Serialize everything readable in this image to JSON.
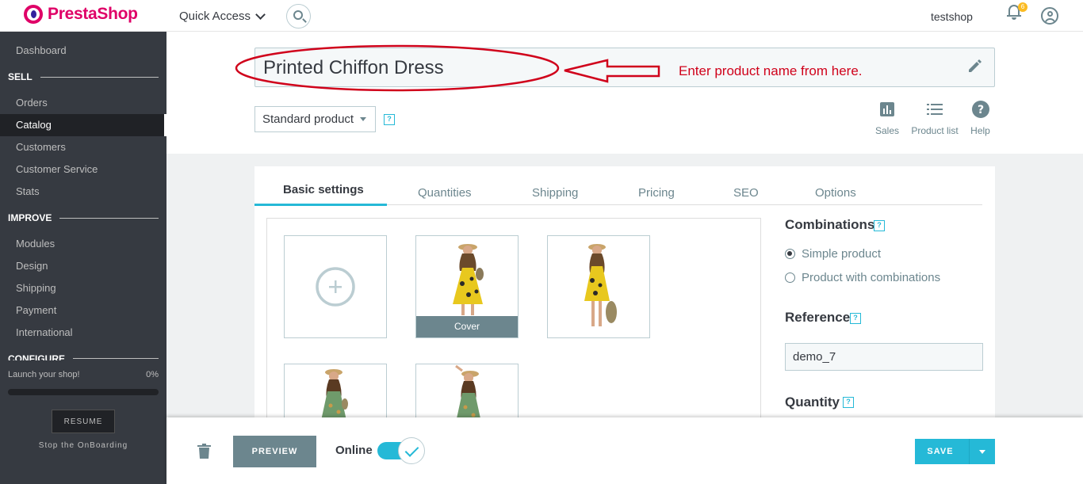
{
  "header": {
    "brand": "PrestaShop",
    "quick_access": "Quick Access",
    "shop_name": "testshop",
    "notification_count": "6"
  },
  "sidebar": {
    "dashboard": "Dashboard",
    "sections": [
      {
        "title": "SELL",
        "items": [
          "Orders",
          "Catalog",
          "Customers",
          "Customer Service",
          "Stats"
        ]
      },
      {
        "title": "IMPROVE",
        "items": [
          "Modules",
          "Design",
          "Shipping",
          "Payment",
          "International"
        ]
      },
      {
        "title": "CONFIGURE"
      }
    ],
    "active_item": "Catalog",
    "launch_label": "Launch your shop!",
    "launch_percent": "0%",
    "launch_progress": 0,
    "resume_label": "RESUME",
    "stop_label": "Stop the OnBoarding"
  },
  "product": {
    "name": "Printed Chiffon Dress",
    "annotation": "Enter product name from here.",
    "type_select": "Standard product",
    "help_mark": "?"
  },
  "toolbar": {
    "sales": "Sales",
    "product_list": "Product list",
    "help": "Help"
  },
  "tabs": [
    "Basic settings",
    "Quantities",
    "Shipping",
    "Pricing",
    "SEO",
    "Options"
  ],
  "images": {
    "cover_label": "Cover"
  },
  "settings": {
    "combinations_title": "Combinations",
    "simple_product": "Simple product",
    "product_with_combinations": "Product with combinations",
    "reference_title": "Reference",
    "reference_value": "demo_7",
    "quantity_title": "Quantity"
  },
  "footer": {
    "preview": "PREVIEW",
    "online": "Online",
    "save": "SAVE"
  },
  "colors": {
    "brand_pink": "#df0067",
    "accent_blue": "#25b9d7",
    "sidebar_bg": "#363a41",
    "annotation_red": "#d0021b"
  }
}
